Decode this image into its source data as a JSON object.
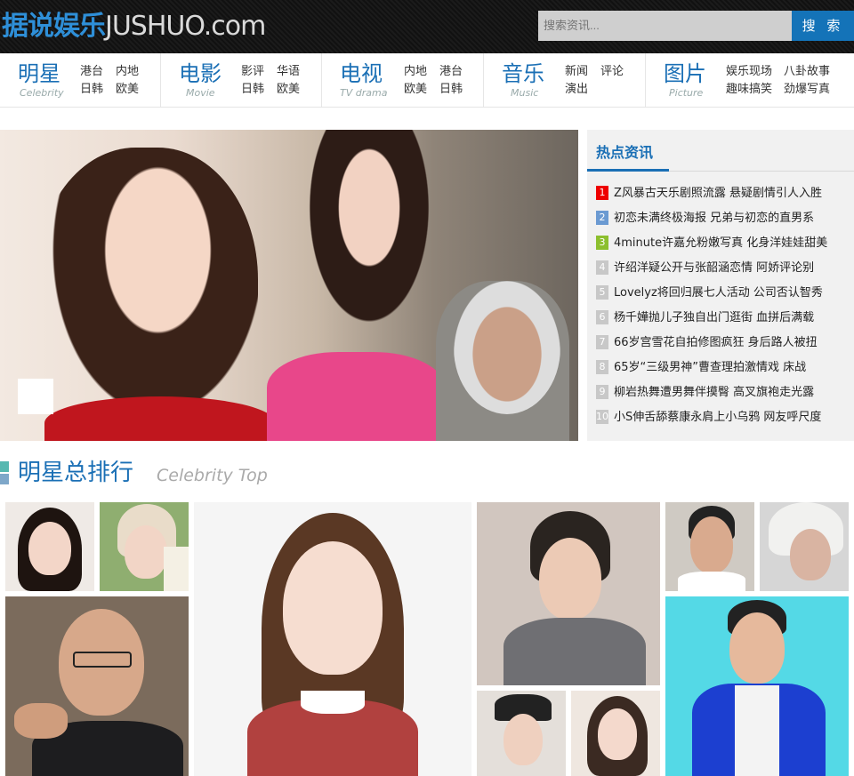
{
  "header": {
    "logo_cn": "据说娱乐",
    "logo_en": "JUSHUO.com",
    "search_placeholder": "搜索资讯...",
    "search_button": "搜 索"
  },
  "nav": [
    {
      "title": "明星",
      "sub": "Celebrity",
      "links": [
        "港台",
        "内地",
        "日韩",
        "欧美"
      ]
    },
    {
      "title": "电影",
      "sub": "Movie",
      "links": [
        "影评",
        "华语",
        "日韩",
        "欧美"
      ]
    },
    {
      "title": "电视",
      "sub": "TV drama",
      "links": [
        "内地",
        "港台",
        "欧美",
        "日韩"
      ]
    },
    {
      "title": "音乐",
      "sub": "Music",
      "links": [
        "新闻",
        "评论",
        "演出"
      ]
    },
    {
      "title": "图片",
      "sub": "Picture",
      "links": [
        "娱乐现场",
        "八卦故事",
        "趣味搞笑",
        "劲爆写真"
      ]
    }
  ],
  "hot": {
    "title": "热点资讯",
    "items": [
      {
        "num": "1",
        "text": "Z风暴古天乐剧照流露 悬疑剧情引人入胜"
      },
      {
        "num": "2",
        "text": "初恋未满终极海报 兄弟与初恋的直男系"
      },
      {
        "num": "3",
        "text": "4minute许嘉允粉嫩写真 化身洋娃娃甜美"
      },
      {
        "num": "4",
        "text": "许绍洋疑公开与张韶涵恋情 阿娇评论别"
      },
      {
        "num": "5",
        "text": "Lovelyz将回归展七人活动 公司否认智秀"
      },
      {
        "num": "6",
        "text": "杨千嬅抛儿子独自出门逛街 血拼后满载"
      },
      {
        "num": "7",
        "text": "66岁宫雪花自拍修图疯狂 身后路人被扭"
      },
      {
        "num": "8",
        "text": "65岁“三级男神”曹查理拍激情戏 床战"
      },
      {
        "num": "9",
        "text": "柳岩热舞遭男舞伴摸臀 高叉旗袍走光露"
      },
      {
        "num": "10",
        "text": "小S伸舌舔蔡康永肩上小乌鸦 网友呼尺度"
      }
    ]
  },
  "section": {
    "title": "明星总排行",
    "sub": "Celebrity Top"
  },
  "colors": {
    "accent": "#1a6fb5",
    "search_button": "#1473b8",
    "rank1": "#e00000",
    "rank2": "#6b9ad2",
    "rank3": "#8cbf2e"
  }
}
